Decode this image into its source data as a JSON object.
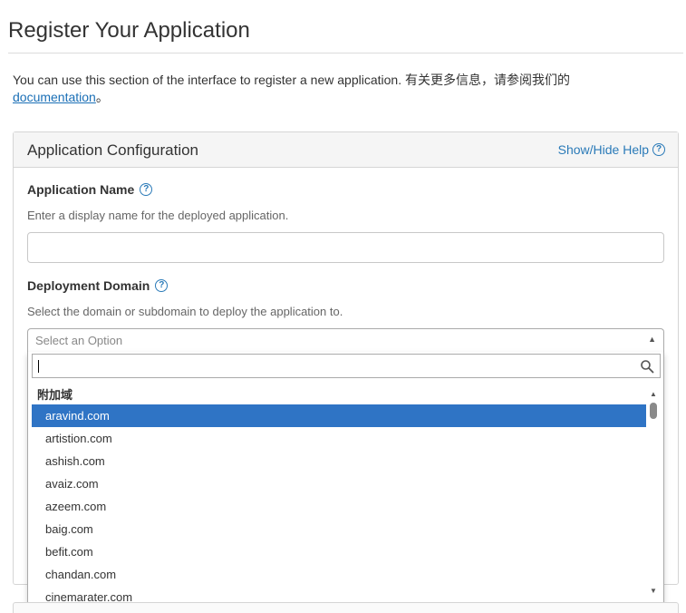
{
  "page": {
    "title": "Register Your Application",
    "intro_text": "You can use this section of the interface to register a new application. 有关更多信息，请参阅我们的",
    "intro_link": "documentation",
    "intro_end": "。"
  },
  "panel": {
    "title": "Application Configuration",
    "help_toggle": "Show/Hide Help"
  },
  "fields": {
    "app_name": {
      "label": "Application Name",
      "help": "Enter a display name for the deployed application.",
      "value": ""
    },
    "domain": {
      "label": "Deployment Domain",
      "help": "Select the domain or subdomain to deploy the application to.",
      "placeholder": "Select an Option"
    }
  },
  "dropdown": {
    "search_value": "",
    "group_label": "附加域",
    "options": [
      "aravind.com",
      "artistion.com",
      "ashish.com",
      "avaiz.com",
      "azeem.com",
      "baig.com",
      "befit.com",
      "chandan.com",
      "cinemarater.com"
    ],
    "selected": "aravind.com"
  },
  "colors": {
    "accent": "#2f74c5",
    "link": "#1a6fb6"
  }
}
